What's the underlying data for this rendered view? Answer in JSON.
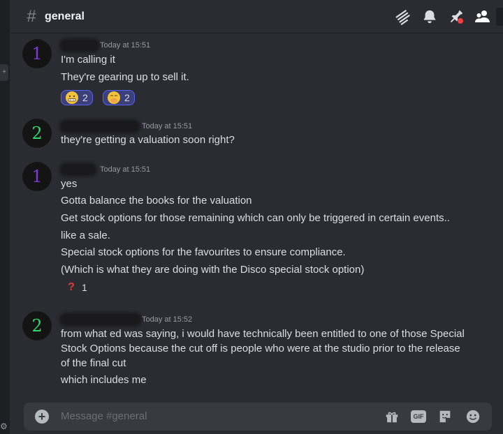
{
  "header": {
    "hash_glyph": "#",
    "title": "general"
  },
  "messages": [
    {
      "avatar_text": "1",
      "avatar_color": "#7a3bd6",
      "timestamp": "Today at 15:51",
      "lines": [
        "I'm calling it",
        "They're gearing up to sell it."
      ],
      "reactions": [
        {
          "emoji": "grimacing-face",
          "count": "2"
        },
        {
          "emoji": "face-with-hand-over-mouth",
          "count": "2"
        }
      ]
    },
    {
      "avatar_text": "2",
      "avatar_color": "#2bd96a",
      "timestamp": "Today at 15:51",
      "lines": [
        "they're getting a valuation soon right?"
      ]
    },
    {
      "avatar_text": "1",
      "avatar_color": "#7a3bd6",
      "timestamp": "Today at 15:51",
      "lines": [
        "yes",
        "Gotta balance the books for the valuation",
        "Get stock options for those remaining which can only be triggered in certain events..",
        "like a sale.",
        "Special stock options for the favourites to ensure compliance.",
        "(Which is what they are doing with the Disco special stock option)"
      ],
      "reactions": [
        {
          "emoji": "red-question-mark",
          "count": "1"
        }
      ]
    },
    {
      "avatar_text": "2",
      "avatar_color": "#2bd96a",
      "timestamp": "Today at 15:52",
      "lines": [
        "from what ed was saying, i would have technically been entitled to one of those Special Stock Options because the cut off is people who were at the studio prior to the release of the final cut",
        "which includes me"
      ]
    }
  ],
  "composer": {
    "placeholder": "Message #general",
    "gif_label": "GIF"
  },
  "colors": {
    "accent": "#5865f2",
    "background": "#2b2c31",
    "composer": "#383a40"
  }
}
